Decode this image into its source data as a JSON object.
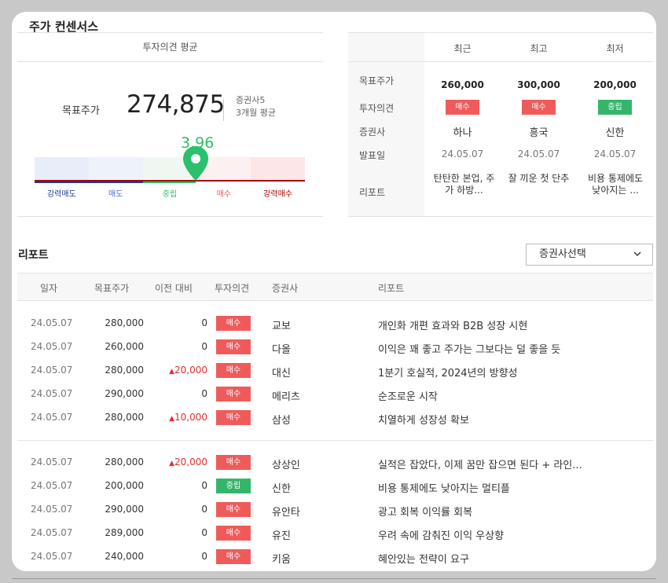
{
  "section_title": "주가 컨센서스",
  "summary": {
    "header": "투자의견 평균",
    "target_label": "목표주가",
    "target_value": "274,875",
    "meta_line1": "증권사5",
    "meta_line2": "3개월 평균",
    "score": "3.96",
    "score_fraction": 0.6,
    "scale_labels": [
      "강력매도",
      "매도",
      "중립",
      "매수",
      "강력매수"
    ],
    "scale_colors": {
      "strong_sell": "#1e3c8c",
      "sell": "#4a6fd0",
      "hold": "#2bc06b",
      "buy": "#ef5b5b",
      "strong_buy": "#b00000"
    }
  },
  "compare": {
    "columns": [
      "최근",
      "최고",
      "최저"
    ],
    "row_labels": [
      "목표주가",
      "투자의견",
      "증권사",
      "발표일",
      "리포트"
    ],
    "cells": [
      {
        "price": "260,000",
        "opinion": "매수",
        "opinion_type": "buy",
        "broker": "하나",
        "date": "24.05.07",
        "report": "탄탄한 본업, 주가 하방..."
      },
      {
        "price": "300,000",
        "opinion": "매수",
        "opinion_type": "buy",
        "broker": "흥국",
        "date": "24.05.07",
        "report": "잘 끼운 첫 단추"
      },
      {
        "price": "200,000",
        "opinion": "중립",
        "opinion_type": "hold",
        "broker": "신한",
        "date": "24.05.07",
        "report": "비용 통제에도 낮아지는 ..."
      }
    ]
  },
  "reports": {
    "title": "리포트",
    "selector_label": "증권사선택",
    "headers": {
      "date": "일자",
      "target": "목표주가",
      "change": "이전 대비",
      "opinion": "투자의견",
      "broker": "증권사",
      "report": "리포트"
    },
    "rows": [
      {
        "date": "24.05.07",
        "target": "280,000",
        "change": "0",
        "change_up": false,
        "opinion": "매수",
        "opinion_type": "buy",
        "broker": "교보",
        "report": "개인화 개편 효과와 B2B 성장 시현"
      },
      {
        "date": "24.05.07",
        "target": "260,000",
        "change": "0",
        "change_up": false,
        "opinion": "매수",
        "opinion_type": "buy",
        "broker": "다올",
        "report": "이익은 꽤 좋고 주가는 그보다는 덜 좋을 듯"
      },
      {
        "date": "24.05.07",
        "target": "280,000",
        "change": "20,000",
        "change_up": true,
        "opinion": "매수",
        "opinion_type": "buy",
        "broker": "대신",
        "report": "1분기 호실적, 2024년의 방향성"
      },
      {
        "date": "24.05.07",
        "target": "290,000",
        "change": "0",
        "change_up": false,
        "opinion": "매수",
        "opinion_type": "buy",
        "broker": "메리츠",
        "report": "순조로운 시작"
      },
      {
        "date": "24.05.07",
        "target": "280,000",
        "change": "10,000",
        "change_up": true,
        "opinion": "매수",
        "opinion_type": "buy",
        "broker": "삼성",
        "report": "치열하게 성장성 확보"
      },
      {
        "date": "24.05.07",
        "target": "280,000",
        "change": "20,000",
        "change_up": true,
        "opinion": "매수",
        "opinion_type": "buy",
        "broker": "상상인",
        "report": "실적은 잡았다, 이제 꿈만 잡으면 된다 + 라인..."
      },
      {
        "date": "24.05.07",
        "target": "200,000",
        "change": "0",
        "change_up": false,
        "opinion": "중립",
        "opinion_type": "hold",
        "broker": "신한",
        "report": "비용 통제에도 낮아지는 멀티플"
      },
      {
        "date": "24.05.07",
        "target": "290,000",
        "change": "0",
        "change_up": false,
        "opinion": "매수",
        "opinion_type": "buy",
        "broker": "유안타",
        "report": "광고 회복 이익률 회복"
      },
      {
        "date": "24.05.07",
        "target": "289,000",
        "change": "0",
        "change_up": false,
        "opinion": "매수",
        "opinion_type": "buy",
        "broker": "유진",
        "report": "우려 속에 감춰진 이익 우상향"
      },
      {
        "date": "24.05.07",
        "target": "240,000",
        "change": "0",
        "change_up": false,
        "opinion": "매수",
        "opinion_type": "buy",
        "broker": "키움",
        "report": "혜안있는 전략이 요구"
      }
    ]
  }
}
